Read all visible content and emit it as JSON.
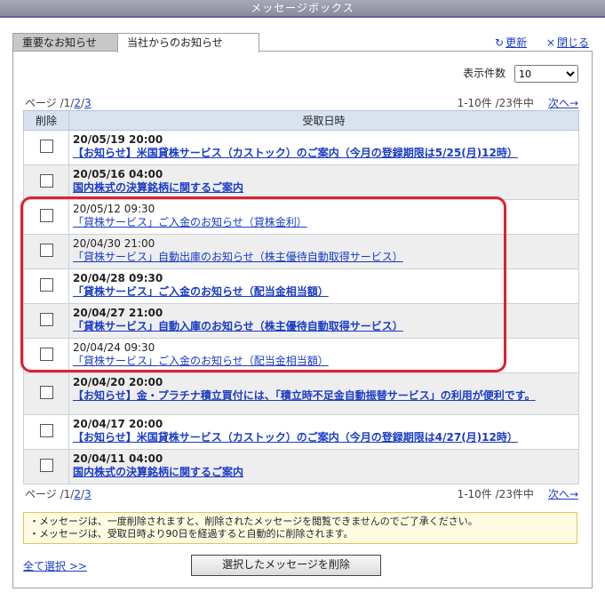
{
  "window": {
    "title": "メッセージボックス"
  },
  "tabs": [
    {
      "label": "重要なお知らせ"
    },
    {
      "label": "当社からのお知らせ"
    }
  ],
  "toplinks": {
    "refresh": "更新",
    "refresh_icon": "↻",
    "close": "閉じる",
    "close_icon": "×"
  },
  "display": {
    "label": "表示件数",
    "selected": "10"
  },
  "pager_top": {
    "prefix": "ページ /",
    "current": "1",
    "sep1": "/",
    "p2": "2",
    "sep2": "/",
    "p3": "3"
  },
  "count_top": {
    "text": "1-10件 /23件中",
    "next": "次へ→"
  },
  "table": {
    "col_delete": "削除",
    "col_date": "受取日時",
    "rows": [
      {
        "date": "20/05/19 20:00",
        "subject": "【お知らせ】米国貸株サービス（カストック）のご案内（今月の登録期限は5/25(月)12時）",
        "bold": true
      },
      {
        "date": "20/05/16 04:00",
        "subject": "国内株式の決算銘柄に関するご案内",
        "bold": true
      },
      {
        "date": "20/05/12 09:30",
        "subject": "「貸株サービス」ご入金のお知らせ（貸株金利）",
        "bold": false
      },
      {
        "date": "20/04/30 21:00",
        "subject": "「貸株サービス」自動出庫のお知らせ（株主優待自動取得サービス）",
        "bold": false
      },
      {
        "date": "20/04/28 09:30",
        "subject": "「貸株サービス」ご入金のお知らせ（配当金相当額）",
        "bold": true
      },
      {
        "date": "20/04/27 21:00",
        "subject": "「貸株サービス」自動入庫のお知らせ（株主優待自動取得サービス）",
        "bold": true
      },
      {
        "date": "20/04/24 09:30",
        "subject": "「貸株サービス」ご入金のお知らせ（配当金相当額）",
        "bold": false
      },
      {
        "date": "20/04/20 20:00",
        "subject": "【お知らせ】金・プラチナ積立買付には、「積立時不足金自動振替サービス」の利用が便利です。",
        "bold": true
      },
      {
        "date": "20/04/17 20:00",
        "subject": "【お知らせ】米国貸株サービス（カストック）のご案内（今月の登録期限は4/27(月)12時）",
        "bold": true
      },
      {
        "date": "20/04/11 04:00",
        "subject": "国内株式の決算銘柄に関するご案内",
        "bold": true
      }
    ]
  },
  "pager_bottom": {
    "prefix": "ページ /",
    "current": "1",
    "sep1": "/",
    "p2": "2",
    "sep2": "/",
    "p3": "3"
  },
  "count_bottom": {
    "text": "1-10件 /23件中",
    "next": "次へ→"
  },
  "notice": {
    "line1": "・メッセージは、一度削除されますと、削除されたメッセージを閲覧できませんのでご了承ください。",
    "line2": "・メッセージは、受取日時より90日を経過すると自動的に削除されます。"
  },
  "footer": {
    "select_all": "全て選択 >>",
    "delete_button": "選択したメッセージを削除"
  },
  "colors": {
    "link": "#1a3cc8",
    "highlight": "#e0202e",
    "header_bg": "#d9e2ef"
  }
}
